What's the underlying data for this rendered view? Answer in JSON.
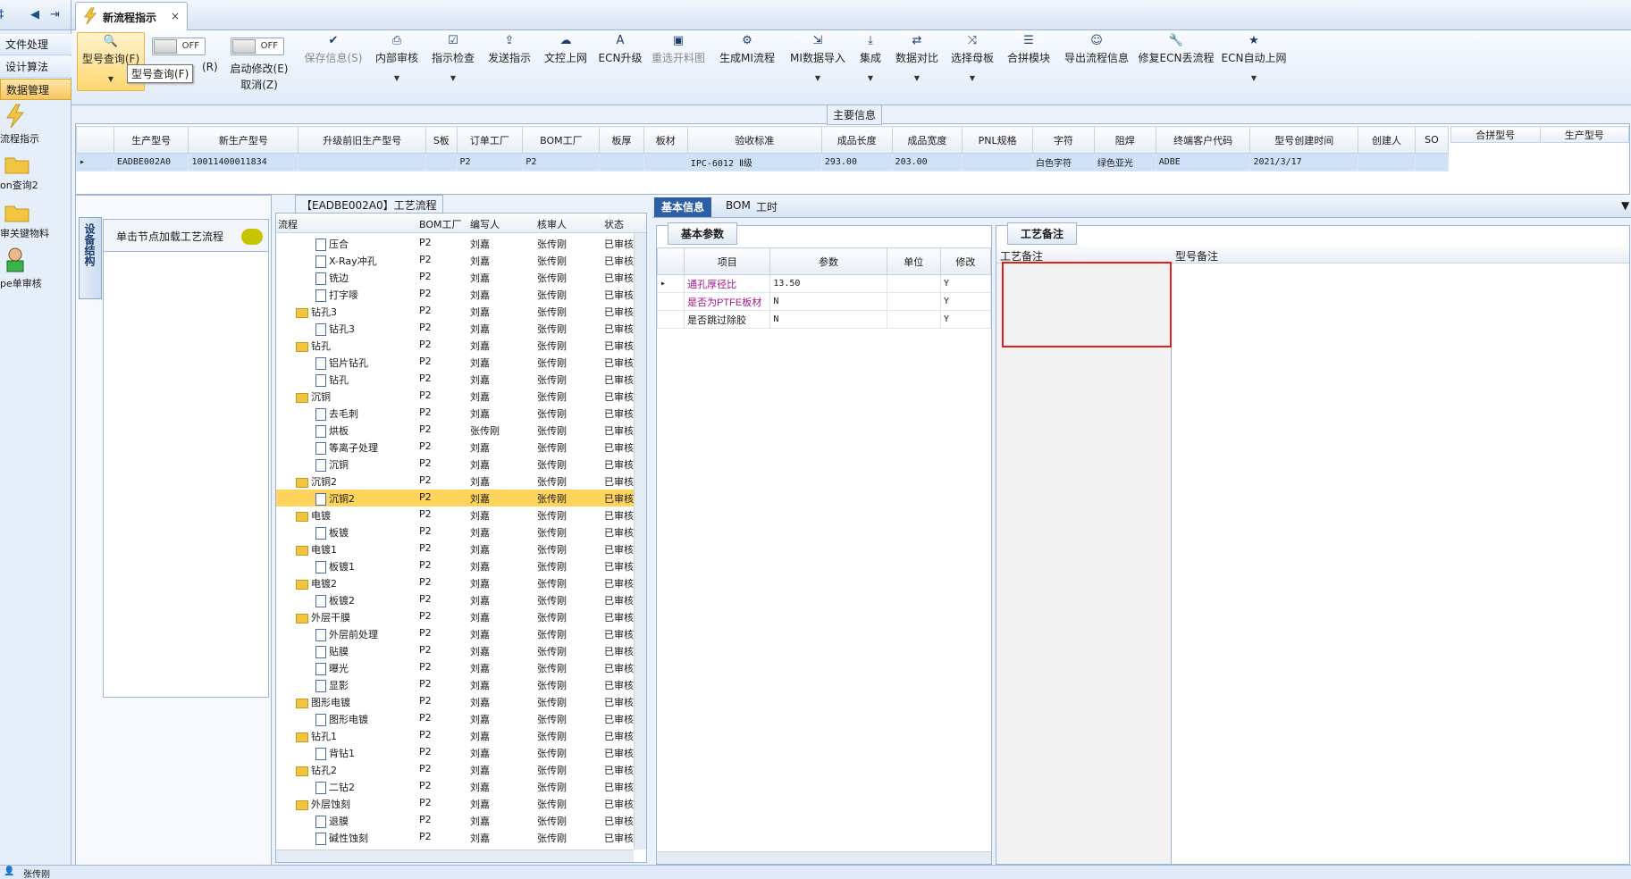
{
  "left_panel": {
    "menus": [
      "文件处理",
      "设计算法",
      "数据管理"
    ],
    "nav": [
      "流程指示",
      "on查询2",
      "审关键物料",
      "pe单审核"
    ],
    "username": "张传刚"
  },
  "tab": {
    "title": "新流程指示",
    "close": "×"
  },
  "ribbon": {
    "query": "型号查询(F)",
    "tooltip": "型号查询(F)",
    "off": "OFF",
    "off2": "OFF",
    "partial_label": "(R)",
    "start_modify": "启动修改(E)",
    "cancel": "取消(Z)",
    "buttons": [
      "保存信息(S)",
      "内部审核",
      "指示检查",
      "发送指示",
      "文控上网",
      "ECN升级",
      "重选开料图",
      "生成MI流程",
      "MI数据导入",
      "集成",
      "数据对比",
      "选择母板",
      "合拼模块",
      "导出流程信息",
      "修复ECN丢流程",
      "ECN自动上网"
    ]
  },
  "main_info": {
    "section_title": "主要信息",
    "columns": [
      "生产型号",
      "新生产型号",
      "升级前旧生产型号",
      "S板",
      "订单工厂",
      "BOM工厂",
      "板厚",
      "板材",
      "验收标准",
      "成品长度",
      "成品宽度",
      "PNL规格",
      "字符",
      "阻焊",
      "终端客户代码",
      "型号创建时间",
      "创建人",
      "SO"
    ],
    "row": [
      "EADBE002A0",
      "10011400011834",
      "",
      "",
      "P2",
      "P2",
      "",
      "",
      "IPC-6012 Ⅱ级",
      "293.00",
      "203.00",
      "",
      "白色字符",
      "绿色亚光",
      "ADBE",
      "2021/3/17",
      "",
      ""
    ],
    "merge_columns": [
      "合拼型号",
      "生产型号"
    ]
  },
  "left_area": {
    "vtab": "设备结构",
    "click_hint": "单击节点加载工艺流程"
  },
  "process_tree": {
    "title": "【EADBE002A0】工艺流程",
    "columns": [
      "流程",
      "BOM工厂",
      "编写人",
      "核审人",
      "状态"
    ],
    "rows": [
      {
        "name": "压合",
        "level": 2,
        "factory": "P2",
        "writer": "刘嘉",
        "reviewer": "张传刚",
        "status": "已审核"
      },
      {
        "name": "X-Ray冲孔",
        "level": 2,
        "factory": "P2",
        "writer": "刘嘉",
        "reviewer": "张传刚",
        "status": "已审核"
      },
      {
        "name": "铣边",
        "level": 2,
        "factory": "P2",
        "writer": "刘嘉",
        "reviewer": "张传刚",
        "status": "已审核"
      },
      {
        "name": "打字嘜",
        "level": 2,
        "factory": "P2",
        "writer": "刘嘉",
        "reviewer": "张传刚",
        "status": "已审核"
      },
      {
        "name": "钻孔3",
        "level": 1,
        "factory": "P2",
        "writer": "刘嘉",
        "reviewer": "张传刚",
        "status": "已审核"
      },
      {
        "name": "钻孔3",
        "level": 2,
        "factory": "P2",
        "writer": "刘嘉",
        "reviewer": "张传刚",
        "status": "已审核"
      },
      {
        "name": "钻孔",
        "level": 1,
        "factory": "P2",
        "writer": "刘嘉",
        "reviewer": "张传刚",
        "status": "已审核"
      },
      {
        "name": "铝片钻孔",
        "level": 2,
        "factory": "P2",
        "writer": "刘嘉",
        "reviewer": "张传刚",
        "status": "已审核"
      },
      {
        "name": "钻孔",
        "level": 2,
        "factory": "P2",
        "writer": "刘嘉",
        "reviewer": "张传刚",
        "status": "已审核"
      },
      {
        "name": "沉铜",
        "level": 1,
        "factory": "P2",
        "writer": "刘嘉",
        "reviewer": "张传刚",
        "status": "已审核"
      },
      {
        "name": "去毛刺",
        "level": 2,
        "factory": "P2",
        "writer": "刘嘉",
        "reviewer": "张传刚",
        "status": "已审核"
      },
      {
        "name": "烘板",
        "level": 2,
        "factory": "P2",
        "writer": "张传刚",
        "reviewer": "张传刚",
        "status": "已审核"
      },
      {
        "name": "等离子处理",
        "level": 2,
        "factory": "P2",
        "writer": "刘嘉",
        "reviewer": "张传刚",
        "status": "已审核"
      },
      {
        "name": "沉铜",
        "level": 2,
        "factory": "P2",
        "writer": "刘嘉",
        "reviewer": "张传刚",
        "status": "已审核"
      },
      {
        "name": "沉铜2",
        "level": 1,
        "factory": "P2",
        "writer": "刘嘉",
        "reviewer": "张传刚",
        "status": "已审核"
      },
      {
        "name": "沉铜2",
        "level": 2,
        "factory": "P2",
        "writer": "刘嘉",
        "reviewer": "张传刚",
        "status": "已审核",
        "selected": true
      },
      {
        "name": "电镀",
        "level": 1,
        "factory": "P2",
        "writer": "刘嘉",
        "reviewer": "张传刚",
        "status": "已审核"
      },
      {
        "name": "板镀",
        "level": 2,
        "factory": "P2",
        "writer": "刘嘉",
        "reviewer": "张传刚",
        "status": "已审核"
      },
      {
        "name": "电镀1",
        "level": 1,
        "factory": "P2",
        "writer": "刘嘉",
        "reviewer": "张传刚",
        "status": "已审核"
      },
      {
        "name": "板镀1",
        "level": 2,
        "factory": "P2",
        "writer": "刘嘉",
        "reviewer": "张传刚",
        "status": "已审核"
      },
      {
        "name": "电镀2",
        "level": 1,
        "factory": "P2",
        "writer": "刘嘉",
        "reviewer": "张传刚",
        "status": "已审核"
      },
      {
        "name": "板镀2",
        "level": 2,
        "factory": "P2",
        "writer": "刘嘉",
        "reviewer": "张传刚",
        "status": "已审核"
      },
      {
        "name": "外层干膜",
        "level": 1,
        "factory": "P2",
        "writer": "刘嘉",
        "reviewer": "张传刚",
        "status": "已审核"
      },
      {
        "name": "外层前处理",
        "level": 2,
        "factory": "P2",
        "writer": "刘嘉",
        "reviewer": "张传刚",
        "status": "已审核"
      },
      {
        "name": "贴膜",
        "level": 2,
        "factory": "P2",
        "writer": "刘嘉",
        "reviewer": "张传刚",
        "status": "已审核"
      },
      {
        "name": "曝光",
        "level": 2,
        "factory": "P2",
        "writer": "刘嘉",
        "reviewer": "张传刚",
        "status": "已审核"
      },
      {
        "name": "显影",
        "level": 2,
        "factory": "P2",
        "writer": "刘嘉",
        "reviewer": "张传刚",
        "status": "已审核"
      },
      {
        "name": "图形电镀",
        "level": 1,
        "factory": "P2",
        "writer": "刘嘉",
        "reviewer": "张传刚",
        "status": "已审核"
      },
      {
        "name": "图形电镀",
        "level": 2,
        "factory": "P2",
        "writer": "刘嘉",
        "reviewer": "张传刚",
        "status": "已审核"
      },
      {
        "name": "钻孔1",
        "level": 1,
        "factory": "P2",
        "writer": "刘嘉",
        "reviewer": "张传刚",
        "status": "已审核"
      },
      {
        "name": "背钻1",
        "level": 2,
        "factory": "P2",
        "writer": "刘嘉",
        "reviewer": "张传刚",
        "status": "已审核"
      },
      {
        "name": "钻孔2",
        "level": 1,
        "factory": "P2",
        "writer": "刘嘉",
        "reviewer": "张传刚",
        "status": "已审核"
      },
      {
        "name": "二钻2",
        "level": 2,
        "factory": "P2",
        "writer": "刘嘉",
        "reviewer": "张传刚",
        "status": "已审核"
      },
      {
        "name": "外层蚀刻",
        "level": 1,
        "factory": "P2",
        "writer": "刘嘉",
        "reviewer": "张传刚",
        "status": "已审核"
      },
      {
        "name": "退膜",
        "level": 2,
        "factory": "P2",
        "writer": "刘嘉",
        "reviewer": "张传刚",
        "status": "已审核"
      },
      {
        "name": "碱性蚀刻",
        "level": 2,
        "factory": "P2",
        "writer": "刘嘉",
        "reviewer": "张传刚",
        "status": "已审核"
      }
    ]
  },
  "middle_tabs": [
    "基本信息",
    "BOM",
    "工时"
  ],
  "params": {
    "tab": "基本参数",
    "columns": [
      "项目",
      "参数",
      "单位",
      "修改"
    ],
    "rows": [
      {
        "item": "通孔厚径比",
        "value": "13.50",
        "unit": "",
        "edit": "Y"
      },
      {
        "item": "是否为PTFE板材",
        "value": "N",
        "unit": "",
        "edit": "Y"
      },
      {
        "item": "是否跳过除胶",
        "value": "N",
        "unit": "",
        "edit": "Y"
      }
    ]
  },
  "notes": {
    "tab": "工艺备注",
    "left_label": "工艺备注",
    "right_label": "型号备注"
  },
  "colors": {
    "accent": "#2d5fa6",
    "highlight": "#ffd45c",
    "alert": "#e0201f"
  }
}
